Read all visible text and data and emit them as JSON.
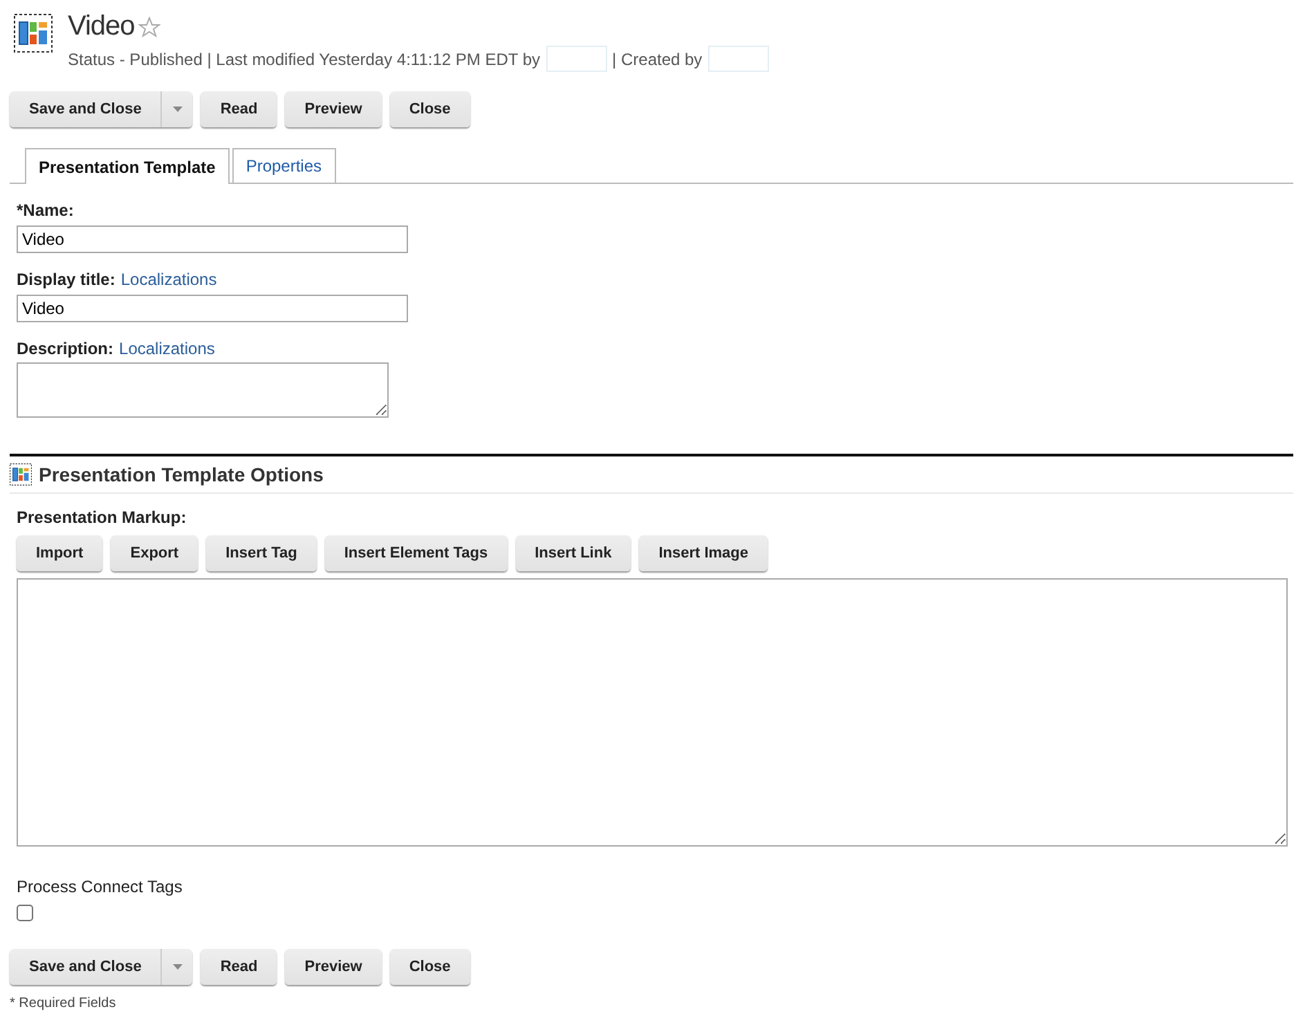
{
  "header": {
    "title": "Video",
    "favorite": false,
    "status": "Status - Published | Last modified Yesterday 4:11:12 PM EDT by",
    "created": "| Created by"
  },
  "toolbar_top": {
    "split": "Save and Close",
    "buttons": [
      "Read",
      "Preview",
      "Close"
    ]
  },
  "tabs": [
    {
      "label": "Presentation Template",
      "selected": true
    },
    {
      "label": "Properties",
      "selected": false
    }
  ],
  "fields": [
    {
      "kind": "input",
      "label": "*Name:",
      "value": "Video"
    },
    {
      "kind": "input",
      "label": "Display title:",
      "link": "Localizations",
      "value": "Video"
    },
    {
      "kind": "textarea",
      "label": "Description:",
      "link": "Localizations"
    }
  ],
  "options": {
    "title": "Presentation Template Options",
    "markup_label": "Presentation Markup:",
    "buttons": [
      "Import",
      "Export",
      "Insert Tag",
      "Insert Element Tags",
      "Insert Link",
      "Insert Image"
    ]
  },
  "process_tags": {
    "label": "Process Connect Tags",
    "checked": false
  },
  "toolbar_bottom": {
    "split": "Save and Close",
    "buttons": [
      "Read",
      "Preview",
      "Close"
    ]
  },
  "footnote": "* Required Fields"
}
